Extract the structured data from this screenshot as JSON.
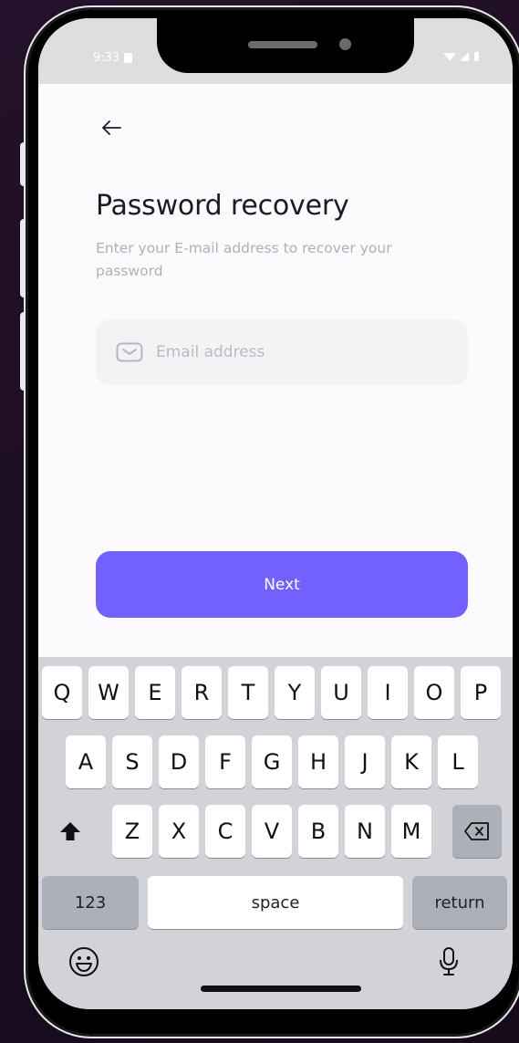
{
  "status_bar": {
    "time": "9:33"
  },
  "header": {
    "back_icon": "arrow-left-icon"
  },
  "main": {
    "title": "Password recovery",
    "subtitle": "Enter your E-mail address to recover your password",
    "email_field": {
      "icon": "mail-icon",
      "placeholder": "Email address",
      "value": ""
    },
    "next_label": "Next"
  },
  "keyboard": {
    "row1": [
      "Q",
      "W",
      "E",
      "R",
      "T",
      "Y",
      "U",
      "I",
      "O",
      "P"
    ],
    "row2": [
      "A",
      "S",
      "D",
      "F",
      "G",
      "H",
      "J",
      "K",
      "L"
    ],
    "row3": [
      "Z",
      "X",
      "C",
      "V",
      "B",
      "N",
      "M"
    ],
    "numbers_label": "123",
    "space_label": "space",
    "return_label": "return",
    "icons": [
      "shift-icon",
      "backspace-icon",
      "emoji-icon",
      "microphone-icon"
    ]
  },
  "colors": {
    "accent": "#7361FD",
    "background": "#FCFAFC",
    "field_background": "#F4F2F4",
    "keyboard_background": "#D2D3D8"
  }
}
